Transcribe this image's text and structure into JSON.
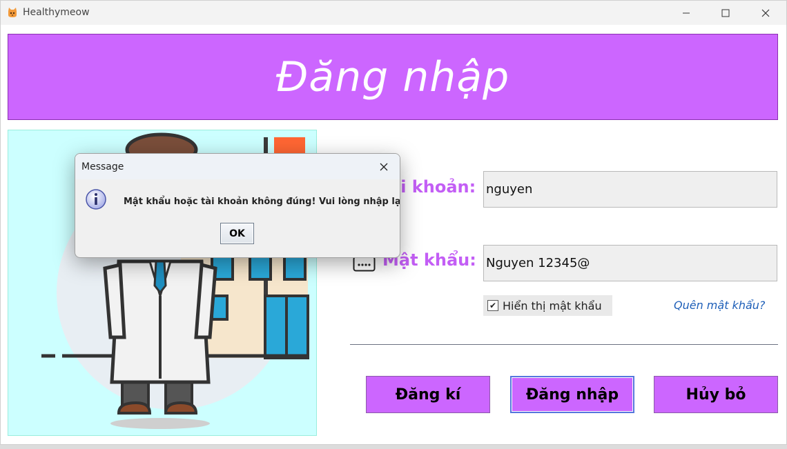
{
  "window": {
    "title": "Healthymeow",
    "controls": {
      "minimize": "minimize-icon",
      "maximize": "maximize-icon",
      "close": "close-icon"
    }
  },
  "banner": {
    "title": "Đăng nhập",
    "color": "#cc66ff"
  },
  "form": {
    "account_label": "ài khoản:",
    "account_value": "nguyen",
    "password_label": "Mật khẩu:",
    "password_value": "Nguyen 12345@",
    "show_password_label": "Hiển thị mật khẩu",
    "show_password_checked": true,
    "forgot_password": "Quên mật khẩu?"
  },
  "buttons": {
    "register": "Đăng kí",
    "login": "Đăng nhập",
    "cancel": "Hủy bỏ"
  },
  "dialog": {
    "title": "Message",
    "message": "Mật khẩu hoặc tài khoản không đúng! Vui lòng nhập lại.",
    "ok": "OK",
    "icon": "info-icon"
  },
  "colors": {
    "accent": "#cc66ff",
    "label": "#c35ef5",
    "link": "#1e5fb8",
    "illustration_bg": "#ccffff"
  }
}
